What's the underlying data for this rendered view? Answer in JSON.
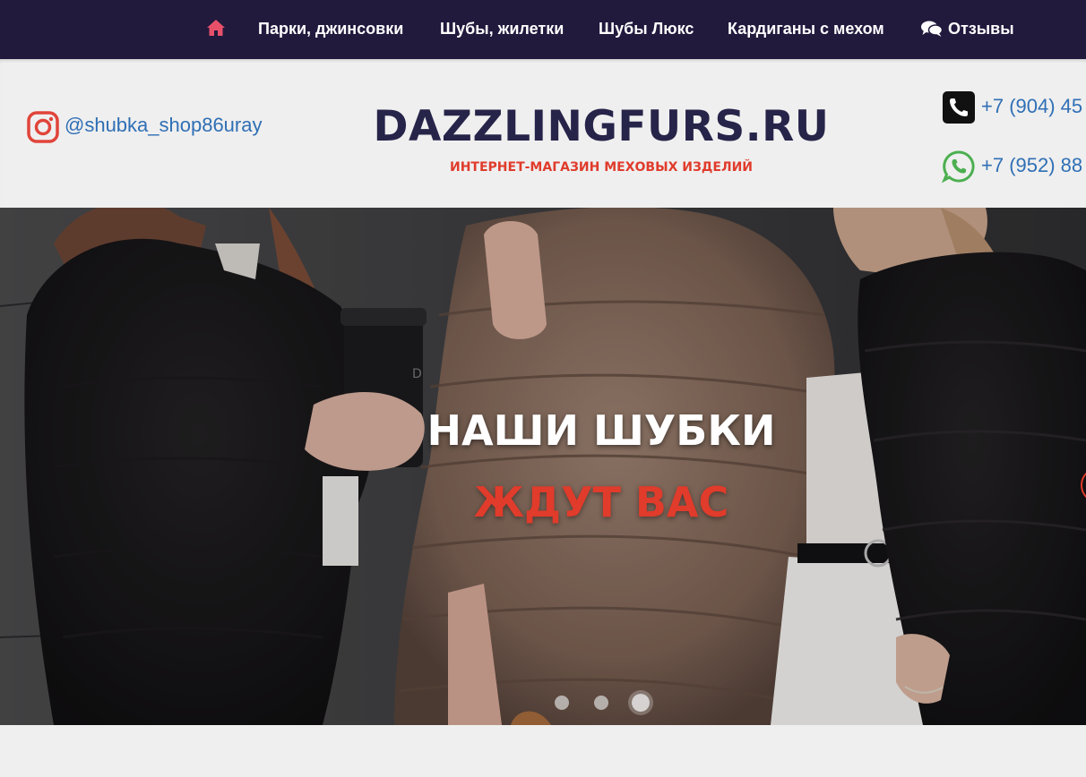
{
  "nav": {
    "items": [
      {
        "label": "Парки, джинсовки"
      },
      {
        "label": "Шубы, жилетки"
      },
      {
        "label": "Шубы Люкс"
      },
      {
        "label": "Кардиганы с мехом"
      },
      {
        "label": "Отзывы"
      }
    ]
  },
  "header": {
    "instagram": "@shubka_shop86uray",
    "logo": "DAZZLINGFURS.RU",
    "tagline": "ИНТЕРНЕТ-МАГАЗИН МЕХОВЫХ ИЗДЕЛИЙ",
    "phone1": "+7 (904) 45",
    "phone2": "+7 (952) 88"
  },
  "hero": {
    "title_line1": "НАШИ ШУБКИ",
    "title_line2": "ЖДУТ ВАС",
    "slides_count": 3,
    "active_slide": 3
  },
  "colors": {
    "nav_bg": "#211a3d",
    "accent_red": "#e03b2b",
    "logo_navy": "#262449",
    "link_blue": "#2f6fb5",
    "home_icon": "#e8506a",
    "whatsapp_green": "#4caf50"
  },
  "icons": [
    "home-icon",
    "comments-icon",
    "instagram-icon",
    "phone-icon",
    "whatsapp-icon"
  ]
}
